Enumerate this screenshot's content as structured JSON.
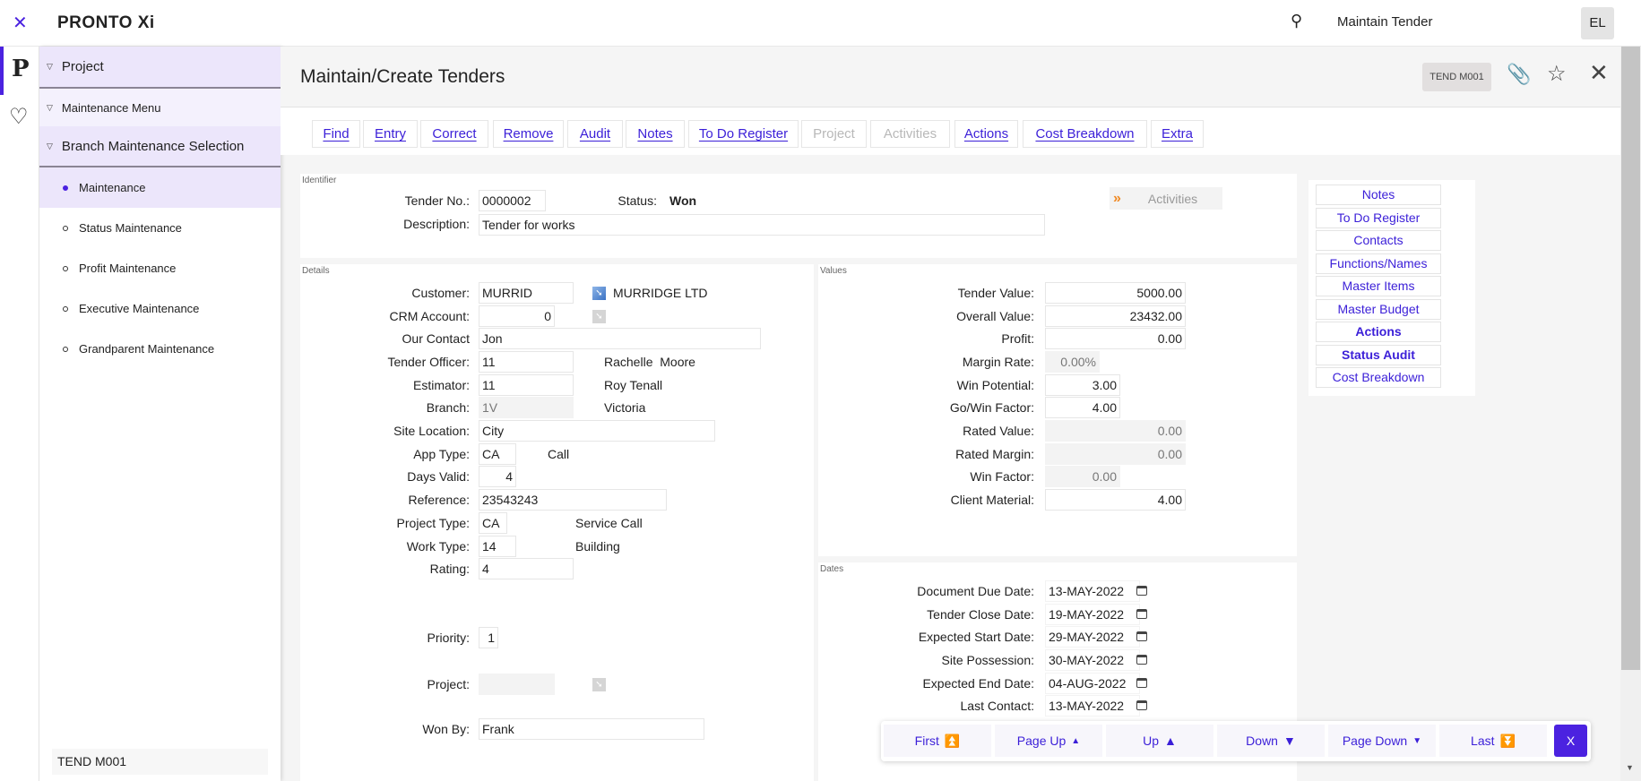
{
  "app": {
    "logo": "PRONTO Xi",
    "search_title": "Maintain Tender",
    "user_initials": "EL",
    "rail_logo": "P"
  },
  "sidebar": {
    "groups": [
      "Project",
      "Maintenance Menu",
      "Branch Maintenance Selection"
    ],
    "items": [
      "Maintenance",
      "Status Maintenance",
      "Profit Maintenance",
      "Executive Maintenance",
      "Grandparent Maintenance"
    ],
    "footer": "TEND M001"
  },
  "header": {
    "title": "Maintain/Create Tenders",
    "code": "TEND M001"
  },
  "toolbar": [
    "Find",
    "Entry",
    "Correct",
    "Remove",
    "Audit",
    "Notes",
    "To Do Register",
    "Project",
    "Activities",
    "Actions",
    "Cost Breakdown",
    "Extra"
  ],
  "identifier": {
    "title": "Identifier",
    "tender_no_label": "Tender No.:",
    "tender_no": "0000002",
    "status_label": "Status:",
    "status": "Won",
    "description_label": "Description:",
    "description": "Tender for works",
    "activities": "Activities"
  },
  "details": {
    "title": "Details",
    "customer_label": "Customer:",
    "customer": "MURRID",
    "customer_name": "MURRIDGE LTD",
    "crm_label": "CRM Account:",
    "crm": "0",
    "contact_label": "Our Contact",
    "contact": "Jon",
    "officer_label": "Tender Officer:",
    "officer": "11",
    "officer_name": "Rachelle  Moore",
    "estimator_label": "Estimator:",
    "estimator": "11",
    "estimator_name": "Roy Tenall",
    "branch_label": "Branch:",
    "branch": "1V",
    "branch_name": "Victoria",
    "site_label": "Site Location:",
    "site": "City",
    "app_type_label": "App Type:",
    "app_type": "CA",
    "app_type_name": "Call",
    "days_label": "Days Valid:",
    "days": "4",
    "reference_label": "Reference:",
    "reference": "23543243",
    "project_type_label": "Project Type:",
    "project_type": "CA",
    "project_type_name": "Service Call",
    "work_type_label": "Work Type:",
    "work_type": "14",
    "work_type_name": "Building",
    "rating_label": "Rating:",
    "rating": "4",
    "priority_label": "Priority:",
    "priority": "1",
    "project_label": "Project:",
    "project": "",
    "won_by_label": "Won By:",
    "won_by": "Frank"
  },
  "values": {
    "title": "Values",
    "rows": [
      {
        "label": "Tender Value:",
        "value": "5000.00"
      },
      {
        "label": "Overall Value:",
        "value": "23432.00"
      },
      {
        "label": "Profit:",
        "value": "0.00"
      },
      {
        "label": "Margin Rate:",
        "value": "0.00%"
      },
      {
        "label": "Win Potential:",
        "value": "3.00"
      },
      {
        "label": "Go/Win Factor:",
        "value": "4.00"
      },
      {
        "label": "Rated Value:",
        "value": "0.00"
      },
      {
        "label": "Rated Margin:",
        "value": "0.00"
      },
      {
        "label": "Win Factor:",
        "value": "0.00"
      },
      {
        "label": "Client Material:",
        "value": "4.00"
      }
    ]
  },
  "dates": {
    "title": "Dates",
    "rows": [
      {
        "label": "Document Due Date:",
        "value": "13-MAY-2022"
      },
      {
        "label": "Tender Close Date:",
        "value": "19-MAY-2022"
      },
      {
        "label": "Expected Start Date:",
        "value": "29-MAY-2022"
      },
      {
        "label": "Site Possession:",
        "value": "30-MAY-2022"
      },
      {
        "label": "Expected End Date:",
        "value": "04-AUG-2022"
      },
      {
        "label": "Last Contact:",
        "value": "13-MAY-2022"
      }
    ]
  },
  "links": [
    "Notes",
    "To Do Register",
    "Contacts",
    "Functions/Names",
    "Master Items",
    "Master Budget",
    "Actions",
    "Status Audit",
    "Cost Breakdown"
  ],
  "nav": {
    "first": "First",
    "page_up": "Page Up",
    "up": "Up",
    "down": "Down",
    "page_down": "Page Down",
    "last": "Last",
    "close": "X"
  },
  "colors": {
    "accent": "#4b22e0",
    "link": "#3b1fd8",
    "sidebar_active": "#ece6fb"
  }
}
